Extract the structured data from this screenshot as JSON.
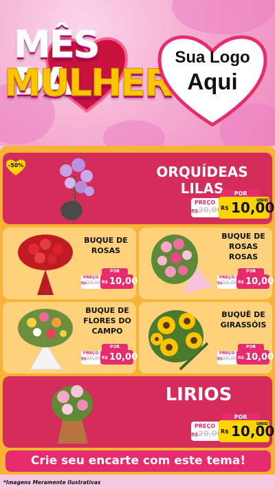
{
  "header": {
    "title_line1": "MÊS DA",
    "title_line2": "MULHER",
    "logo_line1": "Sua Logo",
    "logo_line2": "Aqui"
  },
  "discount_badge": "-50%",
  "price_labels": {
    "preco": "PREÇO",
    "por": "POR",
    "currency": "R$",
    "unit": "UNID"
  },
  "products": [
    {
      "name_lines": [
        "ORQUÍDEAS LILAS"
      ],
      "old_price": "20,00",
      "new_price": "10,00",
      "image_icon": "orchid-image"
    },
    {
      "name_lines": [
        "BUQUE DE",
        "ROSAS"
      ],
      "old_price": "20,00",
      "new_price": "10,00",
      "image_icon": "rose-bouquet-image"
    },
    {
      "name_lines": [
        "BUQUE DE",
        "ROSAS",
        "ROSAS"
      ],
      "old_price": "20,00",
      "new_price": "10,00",
      "image_icon": "pink-rose-bouquet-image"
    },
    {
      "name_lines": [
        "BUQUE DE",
        "FLORES DO",
        "CAMPO"
      ],
      "old_price": "20,00",
      "new_price": "10,00",
      "image_icon": "field-flowers-image"
    },
    {
      "name_lines": [
        "BUQUÊ DE",
        "GIRASSÓIS"
      ],
      "old_price": "20,00",
      "new_price": "10,00",
      "image_icon": "sunflower-bouquet-image"
    },
    {
      "name_lines": [
        "LIRIOS"
      ],
      "old_price": "20,00",
      "new_price": "10,00",
      "image_icon": "lily-image"
    }
  ],
  "cta": "Crie seu encarte com este tema!",
  "footer_note": "*Imagens Meramente Ilustrativas",
  "colors": {
    "pink": "#e62c6c",
    "crimson": "#d42c5b",
    "orange": "#f9b233",
    "yellow": "#ffd400",
    "light_orange": "#fed27c"
  }
}
